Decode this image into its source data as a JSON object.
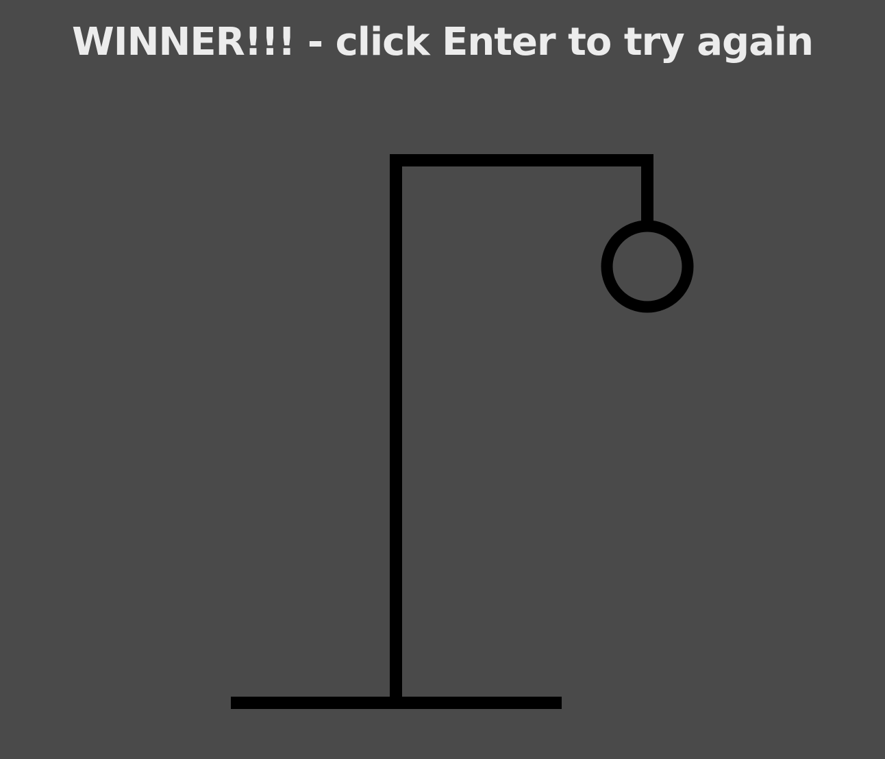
{
  "game": {
    "status_message": "WINNER!!! - click Enter to try again",
    "wrong_guesses_drawn": 1,
    "body_parts_visible": [
      "head"
    ]
  },
  "colors": {
    "background": "#4a4a4a",
    "text": "#ececec",
    "drawing": "#000000"
  }
}
